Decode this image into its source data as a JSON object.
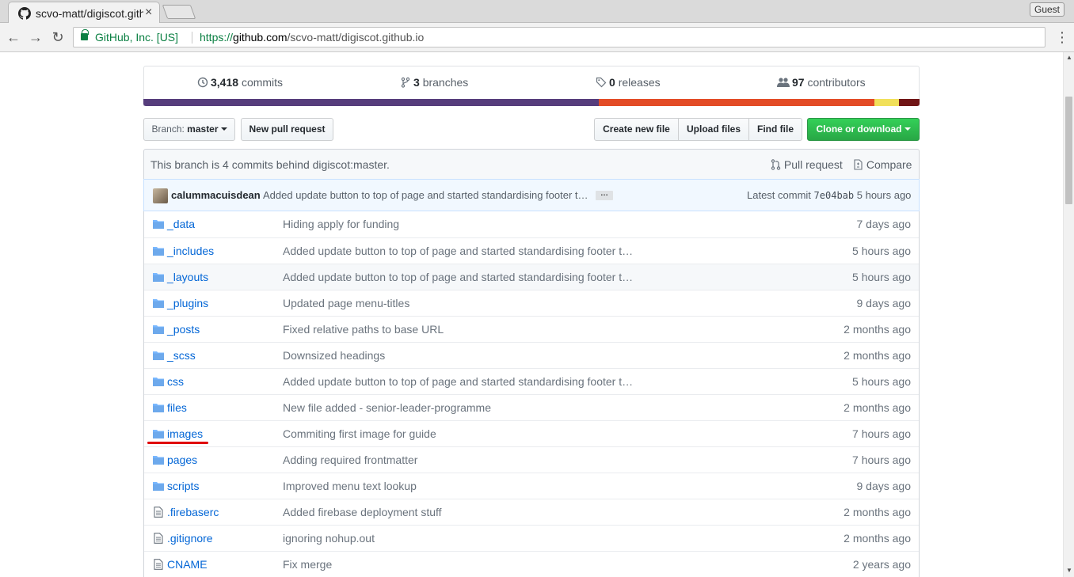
{
  "browser": {
    "tab_title": "scvo-matt/digiscot.github.io",
    "tab_close": "×",
    "profile": "Guest",
    "nav": {
      "back": "←",
      "forward": "→",
      "reload": "↻",
      "menu": "⋮"
    },
    "ev_label": "GitHub, Inc. [US]",
    "url": {
      "scheme": "https://",
      "host": "github.com",
      "path": "/scvo-matt/digiscot.github.io"
    }
  },
  "summary": {
    "commits_count": "3,418",
    "commits_label": "commits",
    "branches_count": "3",
    "branches_label": "branches",
    "releases_count": "0",
    "releases_label": "releases",
    "contributors_count": "97",
    "contributors_label": "contributors"
  },
  "languages_bar": [
    {
      "color": "#563d7c",
      "percent": 58.7
    },
    {
      "color": "#e34c26",
      "percent": 35.5
    },
    {
      "color": "#f1e05a",
      "percent": 3.1
    },
    {
      "color": "#701516",
      "percent": 2.7
    }
  ],
  "toolbar": {
    "branch_label": "Branch:",
    "branch_value": "master",
    "new_pr": "New pull request",
    "create_file": "Create new file",
    "upload_files": "Upload files",
    "find_file": "Find file",
    "clone": "Clone or download"
  },
  "branch_info": {
    "message": "This branch is 4 commits behind digiscot:master.",
    "pull_request": "Pull request",
    "compare": "Compare"
  },
  "latest_commit": {
    "author": "calummacuisdean",
    "message": "Added update button to top of page and started standardising footer t…",
    "ellipsis": "…",
    "label": "Latest commit",
    "sha": "7e04bab",
    "age": "5 hours ago"
  },
  "files": [
    {
      "type": "dir",
      "icon": "folder-icon",
      "name": "_data",
      "message": "Hiding apply for funding",
      "age": "7 days ago"
    },
    {
      "type": "dir",
      "icon": "folder-icon",
      "name": "_includes",
      "message": "Added update button to top of page and started standardising footer t…",
      "age": "5 hours ago"
    },
    {
      "type": "dir",
      "icon": "folder-icon",
      "name": "_layouts",
      "message": "Added update button to top of page and started standardising footer t…",
      "age": "5 hours ago"
    },
    {
      "type": "dir",
      "icon": "folder-icon",
      "name": "_plugins",
      "message": "Updated page menu-titles",
      "age": "9 days ago"
    },
    {
      "type": "dir",
      "icon": "folder-icon",
      "name": "_posts",
      "message": "Fixed relative paths to base URL",
      "age": "2 months ago"
    },
    {
      "type": "dir",
      "icon": "folder-icon",
      "name": "_scss",
      "message": "Downsized headings",
      "age": "2 months ago"
    },
    {
      "type": "dir",
      "icon": "folder-icon",
      "name": "css",
      "message": "Added update button to top of page and started standardising footer t…",
      "age": "5 hours ago"
    },
    {
      "type": "dir",
      "icon": "folder-icon",
      "name": "files",
      "message": "New file added - senior-leader-programme",
      "age": "2 months ago"
    },
    {
      "type": "dir",
      "icon": "folder-icon",
      "name": "images",
      "message": "Commiting first image for guide",
      "age": "7 hours ago"
    },
    {
      "type": "dir",
      "icon": "folder-icon",
      "name": "pages",
      "message": "Adding required frontmatter",
      "age": "7 hours ago"
    },
    {
      "type": "dir",
      "icon": "folder-icon",
      "name": "scripts",
      "message": "Improved menu text lookup",
      "age": "9 days ago"
    },
    {
      "type": "file",
      "icon": "file-icon",
      "name": ".firebaserc",
      "message": "Added firebase deployment stuff",
      "age": "2 months ago"
    },
    {
      "type": "file",
      "icon": "file-icon",
      "name": ".gitignore",
      "message": "ignoring nohup.out",
      "age": "2 months ago"
    },
    {
      "type": "file",
      "icon": "file-icon",
      "name": "CNAME",
      "message": "Fix merge",
      "age": "2 years ago"
    }
  ]
}
